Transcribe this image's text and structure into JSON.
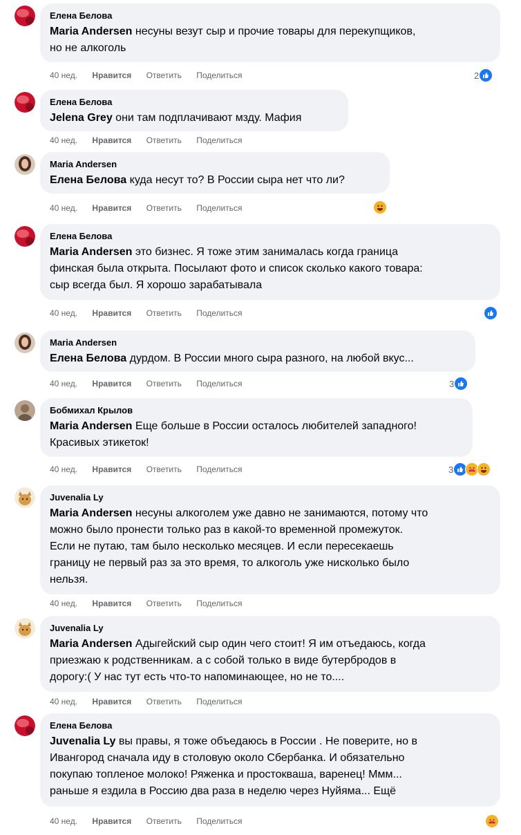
{
  "labels": {
    "like": "Нравится",
    "reply": "Ответить",
    "share": "Поделиться"
  },
  "colors": {
    "bubble": "#f0f2f5",
    "like_blue": "#1877f2",
    "emoji_yellow": "#f7b125",
    "meta_grey": "#65676b"
  },
  "comments": [
    {
      "author": "Елена Белова",
      "mention": "Maria Andersen",
      "text": " несуны везут сыр и прочие товары для перекупщиков,\nно не алкоголь",
      "time": "40 нед.",
      "reaction_count": "2",
      "reactions": [
        "like"
      ],
      "avatar": "red-avatar"
    },
    {
      "author": "Елена Белова",
      "mention": "Jelena Grey",
      "text": " они там подплачивают мзду. Мафия",
      "time": "40 нед.",
      "reaction_count": "",
      "reactions": [],
      "avatar": "red-avatar"
    },
    {
      "author": "Maria Andersen",
      "mention": "Елена Белова",
      "text": " куда несут то? В России сыра нет что ли?",
      "time": "40 нед.",
      "reaction_count": "",
      "reactions": [
        "haha"
      ],
      "avatar": "woman-avatar"
    },
    {
      "author": "Елена Белова",
      "mention": "Maria Andersen",
      "text": " это бизнес. Я тоже этим занималась когда граница\nфинская была открыта. Посылают фото и список сколько какого товара:\nсыр всегда был. Я хорошо зарабатывала",
      "time": "40 нед.",
      "reaction_count": "",
      "reactions": [
        "like"
      ],
      "avatar": "red-avatar"
    },
    {
      "author": "Maria Andersen",
      "mention": "Елена Белова",
      "text": " дурдом. В России много сыра разного, на любой вкус...",
      "time": "40 нед.",
      "reaction_count": "3",
      "reactions": [
        "like"
      ],
      "avatar": "woman-avatar"
    },
    {
      "author": "Бобмихал Крылов",
      "mention": "Maria Andersen",
      "text": " Еще больше в России осталось любителей западного!\nКрасивых этикеток!",
      "time": "40 нед.",
      "reaction_count": "3",
      "reactions": [
        "like",
        "care",
        "haha"
      ],
      "avatar": "man-avatar"
    },
    {
      "author": "Juvenalia Ly",
      "mention": "Maria Andersen",
      "text": " несуны алкоголем уже давно не занимаются, потому что\nможно было пронести только раз в какой-то временной промежуток.\nЕсли не путаю, там было несколько месяцев. И если пересекаешь\nграницу не первый раз за это время, то алкоголь уже нисколько было\nнельзя.",
      "time": "40 нед.",
      "reaction_count": "",
      "reactions": [],
      "avatar": "cat-avatar"
    },
    {
      "author": "Juvenalia Ly",
      "mention": "Maria Andersen",
      "text": " Адыгейский сыр один чего стоит! Я им отъедаюсь, когда\nприезжаю к родственникам. а с собой только в виде бутербродов в\nдорогу:( У нас тут есть что-то напоминающее, но не то....",
      "time": "40 нед.",
      "reaction_count": "",
      "reactions": [],
      "avatar": "cat-avatar"
    },
    {
      "author": "Елена Белова",
      "mention": "Juvenalia Ly",
      "text": " вы правы, я тоже объедаюсь в России . Не поверите, но в\nИвангород сначала иду в столовую около Сбербанка. И обязательно\nпокупаю топленое молоко! Ряженка и простокваша, варенец! Ммм...\nраньше я ездила в Россию два раза в неделю через Нуйяма... Ещё",
      "time": "40 нед.",
      "reaction_count": "",
      "reactions": [
        "care"
      ],
      "avatar": "red-avatar"
    }
  ]
}
